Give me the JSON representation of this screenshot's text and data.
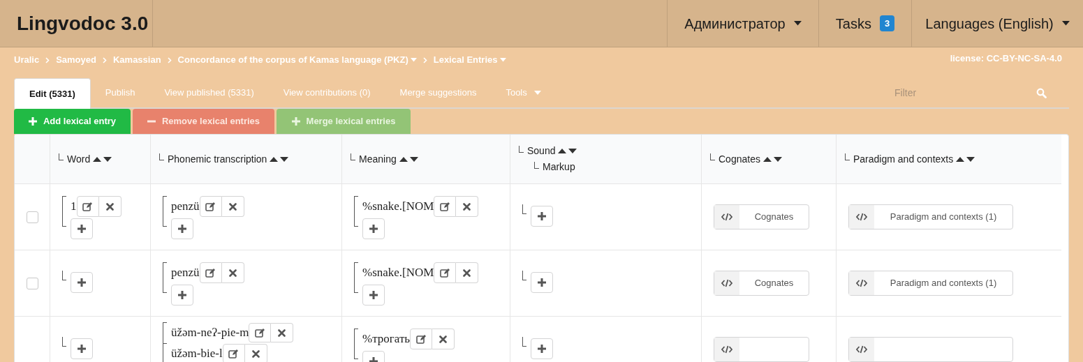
{
  "header": {
    "logo": "Lingvodoc 3.0",
    "menus": [
      {
        "kind": "dropdown",
        "label": "Администратор"
      },
      {
        "kind": "counter",
        "label": "Tasks",
        "count": "3"
      },
      {
        "kind": "dropdown",
        "label": "Languages (English)"
      }
    ]
  },
  "breadcrumbs": [
    {
      "label": "Uralic",
      "dropdown": false
    },
    {
      "label": "Samoyed",
      "dropdown": false
    },
    {
      "label": "Kamassian",
      "dropdown": false
    },
    {
      "label": "Concordance of the corpus of Kamas language (PKZ)",
      "dropdown": true
    },
    {
      "label": "Lexical Entries",
      "dropdown": true
    }
  ],
  "license": "license: CC-BY-NC-SA-4.0",
  "tabs": [
    {
      "label": "Edit (5331)",
      "selected": true,
      "dropdown": false
    },
    {
      "label": "Publish",
      "selected": false,
      "dropdown": false
    },
    {
      "label": "View published (5331)",
      "selected": false,
      "dropdown": false
    },
    {
      "label": "View contributions (0)",
      "selected": false,
      "dropdown": false
    },
    {
      "label": "Merge suggestions",
      "selected": false,
      "dropdown": false
    },
    {
      "label": "Tools",
      "selected": false,
      "dropdown": true
    }
  ],
  "filter": {
    "placeholder": "Filter"
  },
  "actions": [
    {
      "kind": "add",
      "label": "Add lexical entry"
    },
    {
      "kind": "remove",
      "label": "Remove lexical entries"
    },
    {
      "kind": "merge",
      "label": "Merge lexical entries"
    }
  ],
  "table": {
    "columns": [
      {
        "label": "Word"
      },
      {
        "label": "Phonemic transcription"
      },
      {
        "label": "Meaning"
      },
      {
        "label": "Sound",
        "children": [
          {
            "label": "Markup"
          }
        ]
      },
      {
        "label": "Cognates"
      },
      {
        "label": "Paradigm and contexts"
      }
    ],
    "rows": [
      {
        "checked": false,
        "word": [
          "1"
        ],
        "phonemic": [
          "penzü"
        ],
        "meaning": [
          "%snake.[NOM"
        ],
        "sound": [],
        "cognates": "Cognates",
        "paradigm": "Paradigm and contexts (1)"
      },
      {
        "checked": false,
        "word": [],
        "phonemic": [
          "penzü"
        ],
        "meaning": [
          "%snake.[NOM"
        ],
        "sound": [],
        "cognates": "Cognates",
        "paradigm": "Paradigm and contexts (1)"
      },
      {
        "word": [],
        "phonemic": [
          "üžəm-neʔ-pie-m",
          "üžəm-bie-l"
        ],
        "meaning": [
          "%трогать"
        ],
        "sound": []
      }
    ]
  }
}
